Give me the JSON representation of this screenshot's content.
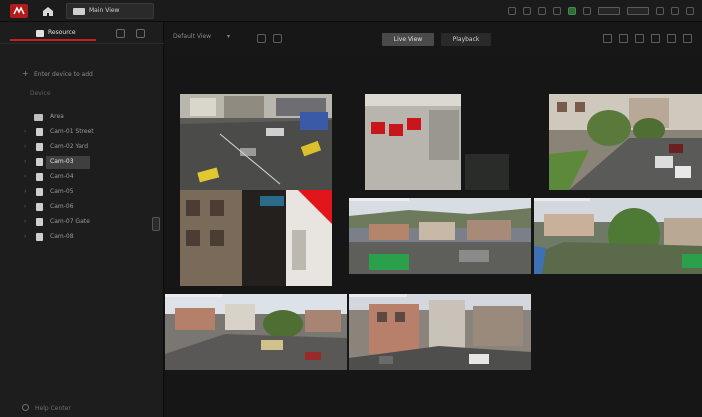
{
  "app": {
    "colors": {
      "accent": "#c42222",
      "background": "#141414",
      "panel": "#1d1d1d"
    },
    "topbar": {
      "logo_icon": "app-logo-icon",
      "home_icon": "home-icon",
      "tab_icon": "monitor-icon",
      "tab_label": "Main View",
      "system_icons": [
        "share-icon",
        "alert-icon",
        "grid-icon",
        "alarm-icon",
        "cpu-icon",
        "network-icon",
        "user-icon",
        "clock-icon",
        "minimize-icon",
        "maximize-icon",
        "close-icon"
      ]
    }
  },
  "sidebar": {
    "tab_label": "Resource",
    "actions": [
      "refresh-icon",
      "settings-icon"
    ],
    "add_label": "Enter device to add",
    "section_label": "Device",
    "items": [
      {
        "label": "Area",
        "type": "group",
        "selected": false
      },
      {
        "label": "Cam-01 Street",
        "type": "camera",
        "selected": false
      },
      {
        "label": "Cam-02 Yard",
        "type": "camera",
        "selected": false
      },
      {
        "label": "Cam-03",
        "type": "camera",
        "selected": true
      },
      {
        "label": "Cam-04",
        "type": "camera",
        "selected": false
      },
      {
        "label": "Cam-05",
        "type": "camera",
        "selected": false
      },
      {
        "label": "Cam-06",
        "type": "camera",
        "selected": false
      },
      {
        "label": "Cam-07 Gate",
        "type": "camera",
        "selected": false
      },
      {
        "label": "Cam-08",
        "type": "camera",
        "selected": false
      }
    ],
    "footer_label": "Help Center"
  },
  "toolbar": {
    "view_select": "Default View",
    "live_label": "Live View",
    "playback_label": "Playback",
    "right_icons": [
      "screenshot-icon",
      "record-icon",
      "volume-icon",
      "window-division-icon",
      "fullscreen-icon",
      "more-icon"
    ]
  },
  "tiles": [
    {
      "name": "tile-street-parking",
      "scene": "street"
    },
    {
      "name": "tile-interior-doorway",
      "scene": "interior"
    },
    {
      "name": "tile-residential-street",
      "scene": "residential"
    },
    {
      "name": "tile-alley-red-wall",
      "scene": "alley"
    },
    {
      "name": "tile-yard-panorama-a",
      "scene": "yard"
    },
    {
      "name": "tile-yard-panorama-b",
      "scene": "yard2"
    },
    {
      "name": "tile-rooftops",
      "scene": "rooftops"
    },
    {
      "name": "tile-building-closeup",
      "scene": "closeup"
    }
  ]
}
